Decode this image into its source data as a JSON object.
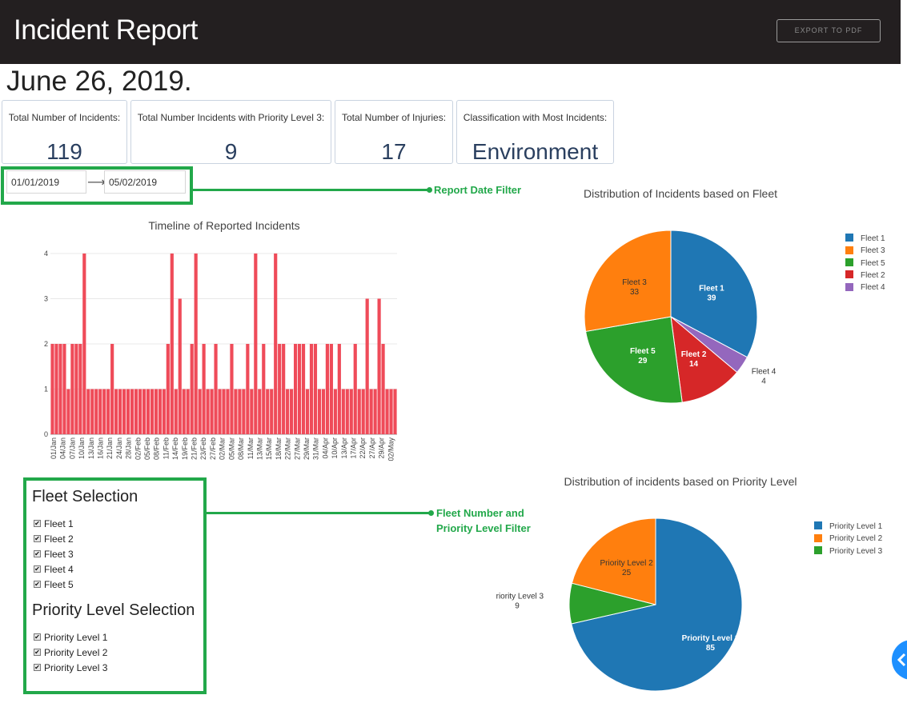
{
  "header": {
    "title": "Incident Report",
    "export_label": "EXPORT TO PDF"
  },
  "report_date": "June 26, 2019.",
  "kpis": [
    {
      "label": "Total Number of Incidents:",
      "value": "119"
    },
    {
      "label": "Total Number Incidents with Priority Level 3:",
      "value": "9"
    },
    {
      "label": "Total Number of Injuries:",
      "value": "17"
    },
    {
      "label": "Classification with Most Incidents:",
      "value": "Environment"
    }
  ],
  "date_filter": {
    "start": "01/01/2019",
    "end": "05/02/2019",
    "annotation": "Report Date Filter"
  },
  "fleet_filter": {
    "title": "Fleet Selection",
    "options": [
      {
        "label": "Fleet 1",
        "checked": true
      },
      {
        "label": "Fleet 2",
        "checked": true
      },
      {
        "label": "Fleet 3",
        "checked": true
      },
      {
        "label": "Fleet 4",
        "checked": true
      },
      {
        "label": "Fleet 5",
        "checked": true
      }
    ]
  },
  "priority_filter": {
    "title": "Priority Level Selection",
    "options": [
      {
        "label": "Priority Level 1",
        "checked": true
      },
      {
        "label": "Priority Level 2",
        "checked": true
      },
      {
        "label": "Priority Level 3",
        "checked": true
      }
    ]
  },
  "filter_annotation": {
    "line1": "Fleet Number and",
    "line2": "Priority Level Filter"
  },
  "colors": {
    "bar": "#ef4b59",
    "accent_green": "#22a84a",
    "header_bg": "#231f20",
    "kpi_value": "#2a3f5f"
  },
  "icons": {
    "checkbox": "checkmark-icon",
    "date_arrow": "arrow-right-icon",
    "fab": "chevron-left-icon"
  },
  "chart_data": [
    {
      "type": "bar",
      "title": "Timeline of Reported Incidents",
      "xlabel": "",
      "ylabel": "",
      "ylim": [
        0,
        4.3
      ],
      "yticks": [
        0,
        1,
        2,
        3,
        4
      ],
      "x_tick_labels": [
        "01/Jan",
        "04/Jan",
        "07/Jan",
        "10/Jan",
        "13/Jan",
        "16/Jan",
        "21/Jan",
        "24/Jan",
        "28/Jan",
        "02/Feb",
        "05/Feb",
        "08/Feb",
        "11/Feb",
        "14/Feb",
        "19/Feb",
        "21/Feb",
        "23/Feb",
        "27/Feb",
        "02/Mar",
        "05/Mar",
        "08/Mar",
        "11/Mar",
        "13/Mar",
        "15/Mar",
        "18/Mar",
        "22/Mar",
        "27/Mar",
        "29/Mar",
        "31/Mar",
        "04/Apr",
        "10/Apr",
        "13/Apr",
        "17/Apr",
        "22/Apr",
        "27/Apr",
        "29/Apr",
        "02/May"
      ],
      "values": [
        2,
        2,
        2,
        2,
        1,
        2,
        2,
        2,
        4,
        1,
        1,
        1,
        1,
        1,
        1,
        2,
        1,
        1,
        1,
        1,
        1,
        1,
        1,
        1,
        1,
        1,
        1,
        1,
        1,
        2,
        4,
        1,
        3,
        1,
        1,
        2,
        4,
        1,
        2,
        1,
        1,
        2,
        1,
        1,
        1,
        2,
        1,
        1,
        1,
        2,
        1,
        4,
        1,
        2,
        1,
        1,
        4,
        2,
        2,
        1,
        1,
        2,
        2,
        2,
        1,
        2,
        2,
        1,
        1,
        2,
        2,
        1,
        2,
        1,
        1,
        1,
        2,
        1,
        1,
        3,
        1,
        1,
        3,
        2,
        1,
        1,
        1
      ]
    },
    {
      "type": "pie",
      "title": "Distribution of Incidents based on Fleet",
      "slices": [
        {
          "name": "Fleet 1",
          "value": 39,
          "color": "#1f77b4"
        },
        {
          "name": "Fleet 4",
          "value": 4,
          "color": "#9467bd"
        },
        {
          "name": "Fleet 2",
          "value": 14,
          "color": "#d62728"
        },
        {
          "name": "Fleet 5",
          "value": 29,
          "color": "#2ca02c"
        },
        {
          "name": "Fleet 3",
          "value": 33,
          "color": "#ff7f0e"
        }
      ],
      "legend": [
        "Fleet 1",
        "Fleet 3",
        "Fleet 5",
        "Fleet 2",
        "Fleet 4"
      ],
      "legend_position": "right"
    },
    {
      "type": "pie",
      "title": "Distribution of incidents based on Priority Level",
      "slices": [
        {
          "name": "Priority Level 1",
          "value": 85,
          "color": "#1f77b4"
        },
        {
          "name": "Priority Level 3",
          "value": 9,
          "color": "#2ca02c"
        },
        {
          "name": "Priority Level 2",
          "value": 25,
          "color": "#ff7f0e"
        }
      ],
      "legend": [
        "Priority Level 1",
        "Priority Level 2",
        "Priority Level 3"
      ],
      "legend_position": "right"
    }
  ]
}
